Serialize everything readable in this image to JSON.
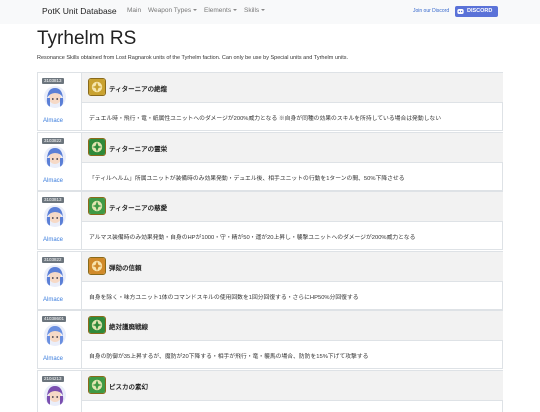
{
  "nav": {
    "brand": "PotK Unit Database",
    "items": [
      {
        "label": "Main",
        "dropdown": false
      },
      {
        "label": "Weapon Types",
        "dropdown": true
      },
      {
        "label": "Elements",
        "dropdown": true
      },
      {
        "label": "Skills",
        "dropdown": true
      }
    ],
    "join_text": "Join our Discord",
    "discord_label": "DISCORD",
    "discord_color": "#5a72d8"
  },
  "page": {
    "title": "Tyrhelm RS",
    "description": "Resonance Skills obtained from Lost Ragnarok units of the Tyrhelm faction. Can only be use by Special units and Tyrhelm units."
  },
  "rows": [
    {
      "unit_id": "3103813",
      "unit_name": "Almace",
      "hair": "#5b7fd6",
      "skill_name": "ティターニアの絶煌",
      "skill_icon": "gold-emblem-icon",
      "skill_color": "#c9a230",
      "skill_text": "デュエル時・飛行・竜・紙属性ユニットへのダメージが200%威力となる ※自身が同種の効果のスキルを所持している場合は発動しない"
    },
    {
      "unit_id": "3103822",
      "unit_name": "Almace",
      "hair": "#5b7fd6",
      "skill_name": "ティターニアの霊栄",
      "skill_icon": "green-emblem-icon",
      "skill_color": "#2f8a3a",
      "skill_text": "「ティルヘルム」所属ユニットが装備時のみ効果発動・デュエル後、相手ユニットの行動を1ターンの間、50%下降させる"
    },
    {
      "unit_id": "3103813",
      "unit_name": "Almace",
      "hair": "#5b7fd6",
      "skill_name": "ティターニアの慈愛",
      "skill_icon": "green-emblem-icon",
      "skill_color": "#3f9a45",
      "skill_text": "アルマス装備時のみ効果発動・自身のHPが1000・守・精が50・運が20上昇し・襲撃ユニットへのダメージが200%威力となる"
    },
    {
      "unit_id": "3103822",
      "unit_name": "Almace",
      "hair": "#5b7fd6",
      "skill_name": "弾劾の信頼",
      "skill_icon": "orange-emblem-icon",
      "skill_color": "#d08a2a",
      "skill_text": "自身を除く・味方ユニット1体のコマンドスキルの使用回数を1回分回復する・さらにHP50%分回復する"
    },
    {
      "unit_id": "41038601",
      "unit_name": "Almace",
      "hair": "#6a8fe0",
      "skill_name": "絶対護廃戦線",
      "skill_icon": "green-emblem-icon",
      "skill_color": "#2f8a3a",
      "skill_text": "自身の防御が35上昇するが、魔防が20下降する・相手が飛行・竜・襲馬の場合、防防を15%下げて攻撃する"
    },
    {
      "unit_id": "2104213",
      "unit_name": "Almace",
      "hair": "#7a4fb0",
      "skill_name": "ピスカの素幻",
      "skill_icon": "green-emblem-icon",
      "skill_color": "#3f9a45",
      "skill_text": ""
    }
  ]
}
